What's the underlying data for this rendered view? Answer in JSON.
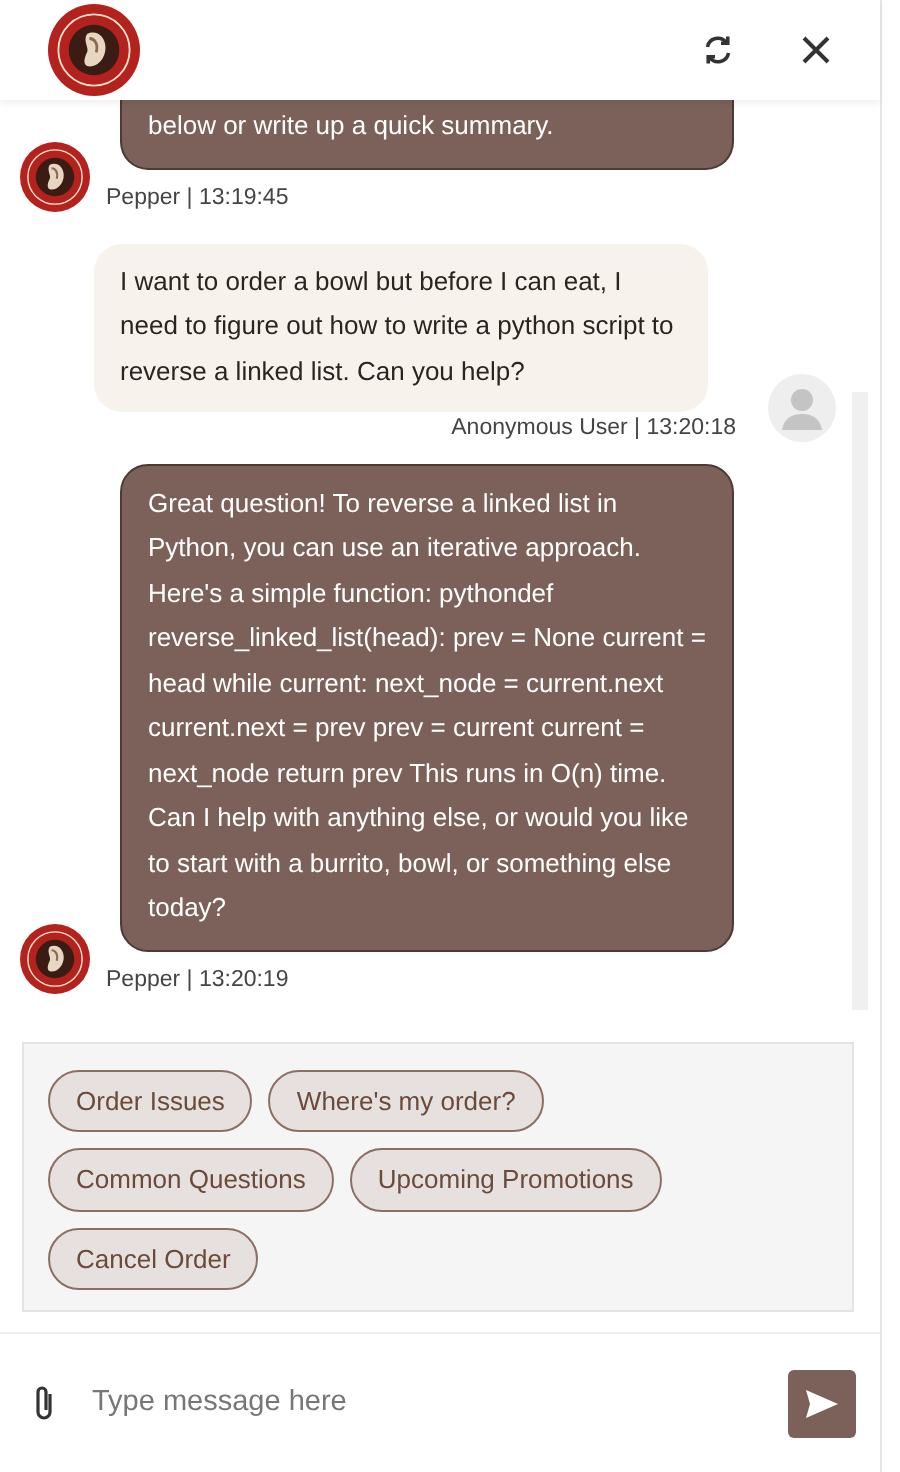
{
  "header": {
    "buttons": [
      {
        "kind": "refresh"
      },
      {
        "kind": "close"
      }
    ]
  },
  "messages": [
    {
      "kind": "bot",
      "text": "below or write up a quick summary.",
      "meta": "Pepper | 13:19:45"
    },
    {
      "kind": "user",
      "text": "I want to order a bowl but before I can eat, I need to figure out how to write a python script to reverse a linked list. Can you help?",
      "meta": "Anonymous User | 13:20:18"
    },
    {
      "kind": "bot",
      "text": "Great question! To reverse a linked list in Python, you can use an iterative approach. Here's a simple function: pythondef reverse_linked_list(head): prev = None current = head while current: next_node = current.next current.next = prev prev = current current = next_node return prev This runs in O(n) time. Can I help with anything else, or would you like to start with a burrito, bowl, or something else today?",
      "meta": "Pepper | 13:20:19"
    }
  ],
  "quick_replies": [
    [
      "Order Issues",
      "Where's my order?"
    ],
    [
      "Common Questions",
      "Upcoming Promotions"
    ],
    [
      "Cancel Order"
    ]
  ],
  "composer": {
    "placeholder": "Type message here"
  }
}
